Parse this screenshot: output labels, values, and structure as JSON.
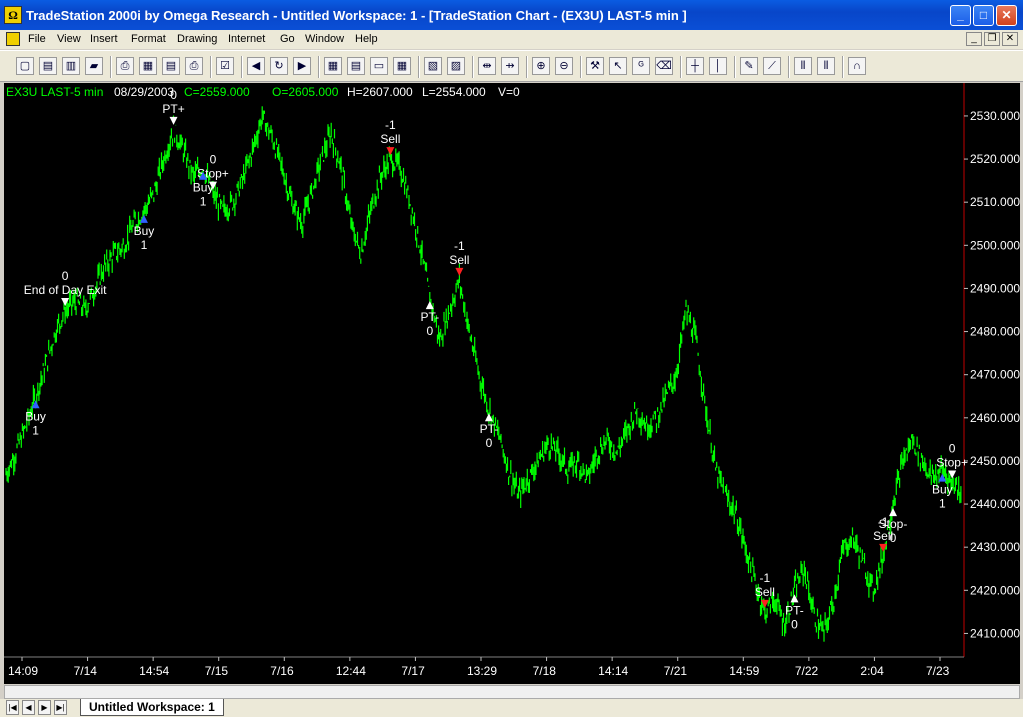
{
  "window": {
    "title": "TradeStation 2000i by Omega Research - Untitled Workspace:  1 - [TradeStation Chart - (EX3U)  LAST-5 min ]",
    "app_icon": "Ω",
    "minimize": "_",
    "maximize": "□",
    "close": "✕"
  },
  "menu": {
    "items": [
      "File",
      "View",
      "Insert",
      "Format",
      "Drawing",
      "Internet",
      "Go",
      "Window",
      "Help"
    ],
    "mdi_minimize": "_",
    "mdi_restore": "❐",
    "mdi_close": "✕"
  },
  "toolbar": {
    "icons": [
      "new-icon",
      "open-icon",
      "save-all-icon",
      "folder-icon",
      "print-preview-icon",
      "chart-icon",
      "page-icon",
      "printer-icon",
      "properties-icon",
      "back-icon",
      "refresh-icon",
      "forward-icon",
      "grid-icon",
      "data-window-icon",
      "window-icon",
      "table-icon",
      "chart-analysis-icon",
      "scale-icon",
      "expand-icon",
      "compress-icon",
      "zoom-in-icon",
      "zoom-out-icon",
      "hammer-icon",
      "pointer-icon",
      "text-g-icon",
      "erase-icon",
      "crosshair-icon",
      "vertical-line-icon",
      "pen-icon",
      "fibonacci-icon",
      "bars-icon",
      "volume-icon",
      "arc-icon"
    ],
    "glyphs": [
      "▢",
      "▤",
      "▥",
      "▰",
      "⎙",
      "▦",
      "▤",
      "⎙",
      "☑",
      "◀",
      "↻",
      "▶",
      "▦",
      "▤",
      "▭",
      "▦",
      "▧",
      "▨",
      "⇹",
      "⇸",
      "⊕",
      "⊖",
      "⚒",
      "↖",
      "ᴳ",
      "⌫",
      "┼",
      "│",
      "✎",
      "⟋",
      "⦀",
      "⦀",
      "∩"
    ]
  },
  "chart_header": {
    "symbol": "EX3U LAST-5 min",
    "date": "08/29/2003",
    "close": "C=2559.000",
    "open": "O=2605.000",
    "high": "H=2607.000",
    "low": "L=2554.000",
    "volume": "V=0"
  },
  "colors": {
    "price_bars": "#00ff00",
    "background": "#000000",
    "text": "#ffffff",
    "buy_marker": "#3060ff",
    "sell_marker": "#ff2020",
    "right_border": "#c00000"
  },
  "chart_data": {
    "type": "line",
    "title": "",
    "xlabel": "",
    "ylabel": "",
    "ylim": [
      2405,
      2533
    ],
    "y_ticks": [
      "2530.000",
      "2520.000",
      "2510.000",
      "2500.000",
      "2490.000",
      "2480.000",
      "2470.000",
      "2460.000",
      "2450.000",
      "2440.000",
      "2430.000",
      "2420.000",
      "2410.000"
    ],
    "x_tick_labels": [
      "14:09",
      "7/14",
      "14:54",
      "7/15",
      "7/16",
      "12:44",
      "7/17",
      "13:29",
      "7/18",
      "14:14",
      "7/21",
      "14:59",
      "7/22",
      "2:04",
      "7/23"
    ],
    "series": [
      {
        "values": [
          2447,
          2452,
          2458,
          2465,
          2472,
          2480,
          2485,
          2487,
          2485,
          2490,
          2495,
          2498,
          2500,
          2505,
          2508,
          2512,
          2520,
          2527,
          2522,
          2516,
          2518,
          2512,
          2508,
          2510,
          2515,
          2522,
          2530,
          2525,
          2518,
          2510,
          2505,
          2512,
          2520,
          2526,
          2518,
          2505,
          2498,
          2508,
          2516,
          2520,
          2518,
          2510,
          2500,
          2488,
          2478,
          2485,
          2492,
          2480,
          2470,
          2462,
          2456,
          2448,
          2442,
          2446,
          2450,
          2454,
          2452,
          2448,
          2450,
          2446,
          2452,
          2455,
          2452,
          2457,
          2462,
          2458,
          2460,
          2465,
          2470,
          2485,
          2478,
          2462,
          2448,
          2442,
          2438,
          2430,
          2422,
          2415,
          2418,
          2412,
          2420,
          2425,
          2414,
          2410,
          2418,
          2430,
          2432,
          2426,
          2420,
          2428,
          2440,
          2450,
          2455,
          2450,
          2446,
          2448,
          2445,
          2443
        ]
      }
    ],
    "annotations": [
      {
        "text": [
          "Buy",
          "1"
        ],
        "type": "buy",
        "x_index": 3
      },
      {
        "text": [
          "0",
          "End of Day Exit"
        ],
        "type": "exit",
        "x_index": 6
      },
      {
        "text": [
          "0",
          "PT+"
        ],
        "type": "exit",
        "x_index": 17
      },
      {
        "text": [
          "Buy",
          "1"
        ],
        "type": "buy",
        "x_index": 14
      },
      {
        "text": [
          "0",
          "Stop+"
        ],
        "type": "exit",
        "x_index": 21
      },
      {
        "text": [
          "Buy",
          "1"
        ],
        "type": "buy",
        "x_index": 20
      },
      {
        "text": [
          "-1",
          "Sell"
        ],
        "type": "sell",
        "x_index": 39
      },
      {
        "text": [
          "PT-",
          "0"
        ],
        "type": "exit",
        "x_index": 43
      },
      {
        "text": [
          "-1",
          "Sell"
        ],
        "type": "sell",
        "x_index": 46
      },
      {
        "text": [
          "PT-",
          "0"
        ],
        "type": "exit",
        "x_index": 49
      },
      {
        "text": [
          "-1",
          "Sell"
        ],
        "type": "sell",
        "x_index": 77
      },
      {
        "text": [
          "PT-",
          "0"
        ],
        "type": "exit",
        "x_index": 80
      },
      {
        "text": [
          "-1",
          "Sell"
        ],
        "type": "sell",
        "x_index": 89
      },
      {
        "text": [
          "Stop-",
          "0"
        ],
        "type": "exit",
        "x_index": 90
      },
      {
        "text": [
          "0",
          "Stop+"
        ],
        "type": "exit",
        "x_index": 96
      },
      {
        "text": [
          "Buy",
          "1"
        ],
        "type": "buy",
        "x_index": 95
      }
    ],
    "grid": false,
    "legend": "none"
  },
  "bottom": {
    "nav": [
      "|◀",
      "◀",
      "▶",
      "▶|"
    ],
    "workspace_tab": "Untitled Workspace:  1"
  }
}
